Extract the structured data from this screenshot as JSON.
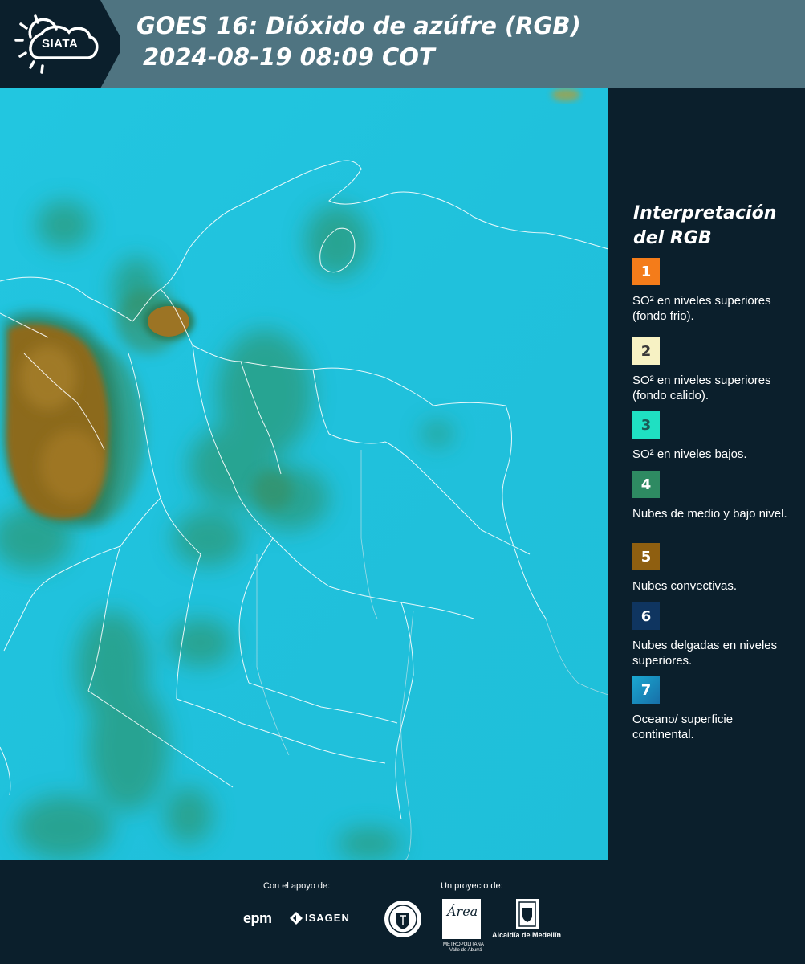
{
  "header": {
    "logo_text": "SIATA",
    "title_line1": "GOES 16: Dióxido de azúfre (RGB)",
    "title_line2": "2024-08-19 08:09 COT"
  },
  "legend": {
    "title_line1": "Interpretación",
    "title_line2": "del RGB",
    "items": [
      {
        "number": "1",
        "text": "SO² en niveles superiores (fondo frio).",
        "color": "#f47c1a",
        "number_color": "#ffffff"
      },
      {
        "number": "2",
        "text": "SO² en niveles superiores (fondo calido).",
        "color": "#f7f2c4",
        "number_color": "#3a3a3a"
      },
      {
        "number": "3",
        "text": "SO² en niveles bajos.",
        "color": "#1fe0c2",
        "number_color": "#1b5a55"
      },
      {
        "number": "4",
        "text": "Nubes de medio y bajo nivel.",
        "color": "#2e8a62",
        "number_color": "#ffffff"
      },
      {
        "number": "5",
        "text": "Nubes convectivas.",
        "color": "#8f5f10",
        "number_color": "#ffffff"
      },
      {
        "number": "6",
        "text": "Nubes delgadas en niveles superiores.",
        "color": "#0f3560",
        "number_color": "#ffffff"
      },
      {
        "number": "7",
        "text": "Oceano/ superficie continental.",
        "color": "#1a8ec4",
        "number_color": "#ffffff"
      }
    ]
  },
  "footer": {
    "support_caption": "Con el apoyo de:",
    "project_caption": "Un proyecto de:",
    "sponsor_epm": "epm",
    "sponsor_isagen": "ISAGEN",
    "partner_area": "Área",
    "partner_area_sub1": "METROPOLITANA",
    "partner_area_sub2": "Valle de Aburrá",
    "partner_medellin": "Alcaldía de Medellín"
  }
}
